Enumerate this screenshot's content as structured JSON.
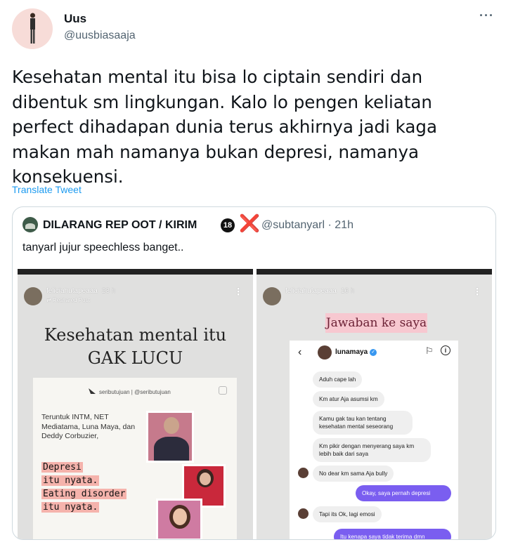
{
  "author": {
    "name": "Uus",
    "handle": "@uusbiasaaja"
  },
  "tweet_text": "Kesehatan mental itu bisa lo ciptain sendiri dan dibentuk sm lingkungan. Kalo lo pengen keliatan perfect dihadapan dunia terus akhirnya jadi kaga makan mah namanya bukan depresi, namanya konsekuensi.",
  "translate_label": "Translate Tweet",
  "more_icon": "···",
  "quoted": {
    "name": "DILARANG REP OOT / KIRIM",
    "badge_18": "18",
    "cross": "❌",
    "meta": "@subtanyarl · 21h",
    "text": "tanyarl jujur speechless banget..",
    "story_left": {
      "user": "feliciahutapeaaa",
      "time": "23 h",
      "reshared": "Reshared Post",
      "headline_1": "Kesehatan mental itu",
      "headline_2": "GAK LUCU",
      "brand": "seributujuan | @seributujuan",
      "to_text": "Teruntuk INTM, NET Mediatama, Luna Maya, dan Deddy Corbuzier,",
      "dep_lines": [
        "Depresi",
        "itu nyata.",
        "Eating disorder",
        "itu nyata."
      ]
    },
    "story_right": {
      "user": "feliciahutapeaaa",
      "time": "16 h",
      "stamp": "Jawaban ke saya",
      "dm_name": "lunamaya",
      "messages": [
        "Aduh cape lah",
        "Km atur Aja asumsi km",
        "Kamu gak tau kan tentang kesehatan mental seseorang",
        "Km pikir dengan menyerang saya km lebih baik dari saya",
        "No dear km sama Aja bully",
        "Okay, saya pernah depresi",
        "Tapi its Ok, lagi emosi",
        "Itu kenapa saya tidak terima dmn"
      ]
    }
  }
}
